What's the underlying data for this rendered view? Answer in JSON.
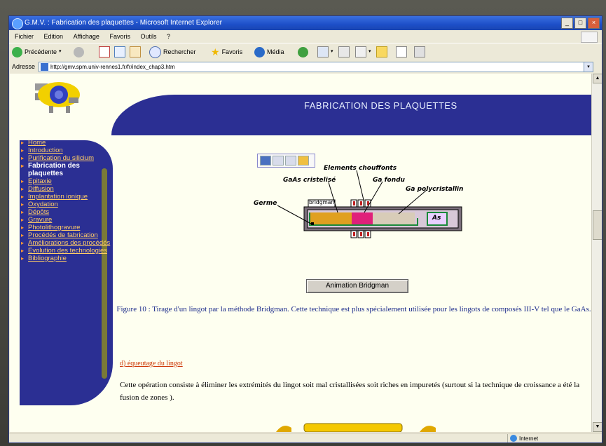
{
  "window": {
    "title": "G.M.V. : Fabrication des plaquettes - Microsoft Internet Explorer",
    "buttons": [
      "_",
      "□",
      "×"
    ]
  },
  "menu": [
    "Fichier",
    "Edition",
    "Affichage",
    "Favoris",
    "Outils",
    "?"
  ],
  "toolbar": {
    "back_label": "Précédente",
    "search_label": "Rechercher",
    "favorites_label": "Favoris",
    "media_label": "Média"
  },
  "address": {
    "label": "Adresse",
    "url": "http://gmv.spm.univ-rennes1.fr/fr/index_chap3.htm"
  },
  "page": {
    "header_title": "FABRICATION DES PLAQUETTES",
    "nav": [
      {
        "label": "Home",
        "active": false
      },
      {
        "label": "Introduction",
        "active": false
      },
      {
        "label": "Purification du silicium",
        "active": false
      },
      {
        "label": "Fabrication des plaquettes",
        "active": true
      },
      {
        "label": "Epitaxie",
        "active": false
      },
      {
        "label": "Diffusion",
        "active": false
      },
      {
        "label": "Implantation ionique",
        "active": false
      },
      {
        "label": "Oxydation",
        "active": false
      },
      {
        "label": "Dépôts",
        "active": false
      },
      {
        "label": "Gravure",
        "active": false
      },
      {
        "label": "Photolithogravure",
        "active": false
      },
      {
        "label": "Procédés de fabrication",
        "active": false
      },
      {
        "label": "Améliorations des procédés",
        "active": false
      },
      {
        "label": "Evolution des technologies",
        "active": false
      },
      {
        "label": "Bibliographie",
        "active": false
      }
    ],
    "diagram": {
      "elements_chauffants": "Elements chouffonts",
      "gaas_cristallise": "GaAs cristelisé",
      "ga_fondu": "Ga fondu",
      "ga_polycristallin": "Ga polycristallin",
      "germe": "Germe",
      "bridgman": "bridgman",
      "as": "As"
    },
    "animation_button": "Animation Bridgman",
    "caption": "Figure 10 : Tirage d'un lingot par la méthode Bridgman. Cette technique est plus spécialement utilisée pour les lingots de composés III-V tel que le GaAs.",
    "section_link": "d) équeutage du lingot",
    "body_text": "Cette opération consiste à éliminer les extrémités du lingot soit mal cristallisées soit riches en impuretés (surtout si la technique de croissance a été la fusion de zones )."
  },
  "status": {
    "zone": "Internet"
  },
  "colors": {
    "header_blue": "#2b2f93",
    "nav_link": "#ffcc66",
    "caption_blue": "#1a2a8a",
    "section_link": "#cc3300",
    "titlebar": "#1d4fc8"
  }
}
